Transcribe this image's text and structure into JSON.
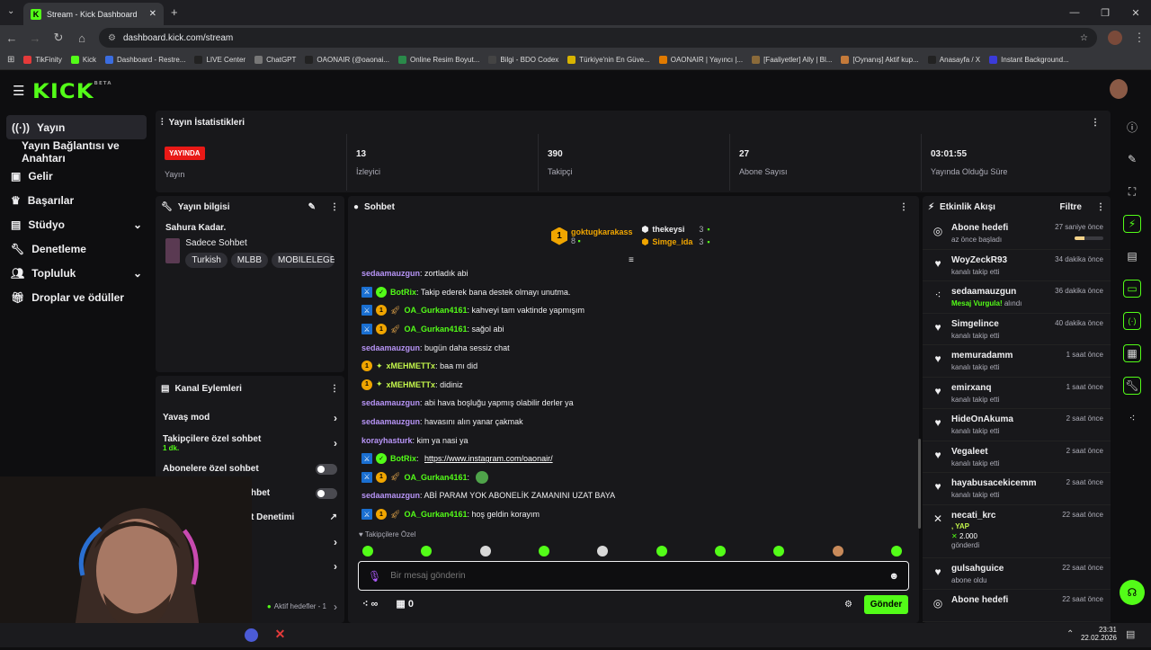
{
  "browser": {
    "tab_title": "Stream - Kick Dashboard",
    "url": "dashboard.kick.com/stream",
    "bookmarks": [
      "TikFinity",
      "Kick",
      "Dashboard - Restre...",
      "LIVE Center",
      "ChatGPT",
      "OAONAIR (@oaonai...",
      "Online Resim Boyut...",
      "Bilgi - BDO Codex",
      "Türkiye'nin En Güve...",
      "OAONAIR | Yayıncı |...",
      "[Faaliyetler] Ally | Bl...",
      "[Oynanış] Aktif kup...",
      "Anasayfa / X",
      "Instant Background..."
    ]
  },
  "brand": {
    "logo": "KICK",
    "beta": "BETA",
    "accent": "#53fc18"
  },
  "sidebar": {
    "items": [
      {
        "label": "Yayın",
        "icon": "broadcast-icon"
      },
      {
        "label": "Yayın Bağlantısı ve Anahtarı",
        "icon": ""
      },
      {
        "label": "Gelir",
        "icon": "money-icon"
      },
      {
        "label": "Başarılar",
        "icon": "trophy-icon"
      },
      {
        "label": "Stüdyo",
        "icon": "studio-icon"
      },
      {
        "label": "Denetleme",
        "icon": "wrench-icon"
      },
      {
        "label": "Topluluk",
        "icon": "people-icon"
      },
      {
        "label": "Droplar ve ödüller",
        "icon": "gift-icon"
      }
    ]
  },
  "stats": {
    "title": "Yayın İstatistikleri",
    "live_badge": "YAYINDA",
    "live_label": "Yayın",
    "viewers": "13",
    "viewers_label": "İzleyici",
    "followers": "390",
    "followers_label": "Takipçi",
    "subs": "27",
    "subs_label": "Abone Sayısı",
    "uptime": "03:01:55",
    "uptime_label": "Yayında Olduğu Süre"
  },
  "stream_info": {
    "title": "Yayın bilgisi",
    "stream_title": "Sahura Kadar.",
    "category": "Sadece Sohbet",
    "tags": [
      "Turkish",
      "MLBB",
      "MOBILELEGEN"
    ]
  },
  "channel_actions": {
    "title": "Kanal Eylemleri",
    "slow_mode": "Yavaş mod",
    "followers_only": "Takipçilere özel sohbet",
    "followers_only_sub": "1 dk.",
    "subs_only": "Abonelere özel sohbet",
    "partial1": "hbet",
    "partial2": "t Denetimi",
    "goals": "Aktif hedefler - 1"
  },
  "chat": {
    "title": "Sohbet",
    "top": [
      {
        "name": "goktugkarakass",
        "count": "8",
        "rank": "1"
      },
      {
        "name": "thekeysi",
        "count": "3"
      },
      {
        "name": "Simge_ida",
        "count": "3"
      }
    ],
    "messages": [
      {
        "badges": [],
        "name": "sedaamauzgun",
        "color": "purple",
        "text": ": zortladık abi"
      },
      {
        "badges": [
          "mod",
          "verified"
        ],
        "name": "BotRix",
        "color": "green",
        "text": ": Takip ederek bana destek olmayı unutma."
      },
      {
        "badges": [
          "mod",
          "1",
          "rocket"
        ],
        "name": "OA_Gurkan4161",
        "color": "green",
        "text": ": kahveyi tam vaktinde yapmışım"
      },
      {
        "badges": [
          "mod",
          "1",
          "rocket"
        ],
        "name": "OA_Gurkan4161",
        "color": "green",
        "text": ": sağol abi"
      },
      {
        "badges": [],
        "name": "sedaamauzgun",
        "color": "purple",
        "text": ": bugün daha sessiz chat"
      },
      {
        "badges": [
          "1",
          "star"
        ],
        "name": "xMEHMETTx",
        "color": "lime",
        "text": ": baa mı did"
      },
      {
        "badges": [
          "1",
          "star"
        ],
        "name": "xMEHMETTx",
        "color": "lime",
        "text": ": didiniz"
      },
      {
        "badges": [],
        "name": "sedaamauzgun",
        "color": "purple",
        "text": ": abi hava boşluğu yapmış olabilir derler ya"
      },
      {
        "badges": [],
        "name": "sedaamauzgun",
        "color": "purple",
        "text": ": havasını alın yanar çakmak"
      },
      {
        "badges": [],
        "name": "korayhasturk",
        "color": "purple",
        "text": ": kim ya nasi ya"
      },
      {
        "badges": [
          "mod",
          "verified"
        ],
        "name": "BotRix",
        "color": "green",
        "text": ": ",
        "link": "https://www.instagram.com/oaonair/"
      },
      {
        "badges": [
          "mod",
          "1",
          "rocket"
        ],
        "name": "OA_Gurkan4161",
        "color": "green",
        "text": ": ",
        "emote": true
      },
      {
        "badges": [],
        "name": "sedaamauzgun",
        "color": "purple",
        "text": ": ABİ PARAM YOK ABONELİK ZAMANINI UZAT BAYA"
      },
      {
        "badges": [
          "mod",
          "1",
          "rocket"
        ],
        "name": "OA_Gurkan4161",
        "color": "green",
        "text": ": hoş geldin korayım"
      }
    ],
    "followers_only_label": "Takipçilere Özel",
    "placeholder": "Bir mesaj gönderin",
    "points": "∞",
    "gift_count": "0",
    "send": "Gönder"
  },
  "activity": {
    "title": "Etkinlik Akışı",
    "filter": "Filtre",
    "events": [
      {
        "icon": "target-icon",
        "name": "Abone hedefi",
        "sub": "az önce başladı",
        "time": "27 saniye önce",
        "progress": 0.35
      },
      {
        "icon": "heart-icon",
        "name": "WoyZeckR93",
        "sub": "kanalı takip etti",
        "time": "34 dakika önce"
      },
      {
        "icon": "points-icon",
        "name": "sedaamauzgun",
        "sub_hl": "Mesaj Vurgula!",
        "sub": " alındı",
        "time": "36 dakika önce"
      },
      {
        "icon": "heart-icon",
        "name": "Simgelince",
        "sub": "kanalı takip etti",
        "time": "40 dakika önce"
      },
      {
        "icon": "heart-icon",
        "name": "memuradamm",
        "sub": "kanalı takip etti",
        "time": "1 saat önce"
      },
      {
        "icon": "heart-icon",
        "name": "emirxanq",
        "sub": "kanalı takip etti",
        "time": "1 saat önce"
      },
      {
        "icon": "heart-icon",
        "name": "HideOnAkuma",
        "sub": "kanalı takip etti",
        "time": "2 saat önce"
      },
      {
        "icon": "heart-icon",
        "name": "Vegaleet",
        "sub": "kanalı takip etti",
        "time": "2 saat önce"
      },
      {
        "icon": "heart-icon",
        "name": "hayabusacekicemm",
        "sub": "kanalı takip etti",
        "time": "2 saat önce"
      },
      {
        "icon": "kicks-icon",
        "name": "necati_krc",
        "sub_hl": ", YAP",
        "amount": "2.000",
        "sub": "gönderdi",
        "time": "22 saat önce"
      },
      {
        "icon": "heart-icon",
        "name": "gulsahguice",
        "sub": "abone oldu",
        "time": "22 saat önce"
      },
      {
        "icon": "target-icon",
        "name": "Abone hedefi",
        "sub": "",
        "time": "22 saat önce"
      }
    ]
  },
  "taskbar": {
    "time": "23:31",
    "date": "22.02.2026"
  }
}
